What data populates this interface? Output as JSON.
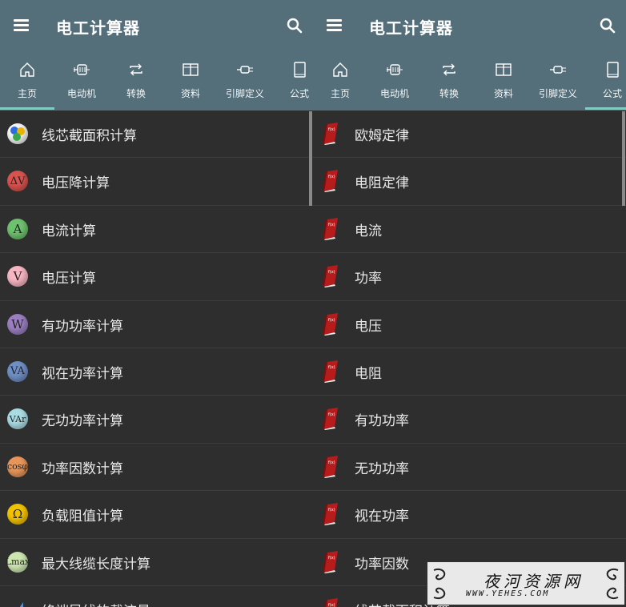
{
  "app": {
    "title": "电工计算器",
    "tabs": [
      {
        "label": "主页",
        "icon": "home-icon"
      },
      {
        "label": "电动机",
        "icon": "motor-icon"
      },
      {
        "label": "转换",
        "icon": "repeat-icon"
      },
      {
        "label": "资料",
        "icon": "book-open-icon"
      },
      {
        "label": "引脚定义",
        "icon": "plug-icon"
      },
      {
        "label": "公式",
        "icon": "book-icon"
      }
    ]
  },
  "left": {
    "selected_tab": "主页",
    "items": [
      {
        "label": "线芯截面积计算",
        "glyph": "",
        "color": "#5a8fd6"
      },
      {
        "label": "电压降计算",
        "glyph": "ΔV",
        "color": "#d9534f"
      },
      {
        "label": "电流计算",
        "glyph": "A",
        "color": "#6ec26e"
      },
      {
        "label": "电压计算",
        "glyph": "V",
        "color": "#f7b6c2"
      },
      {
        "label": "有功功率计算",
        "glyph": "W",
        "color": "#9b7fc0"
      },
      {
        "label": "视在功率计算",
        "glyph": "VA",
        "color": "#6f8fc6"
      },
      {
        "label": "无功功率计算",
        "glyph": "VAr",
        "color": "#a9dbe3"
      },
      {
        "label": "功率因数计算",
        "glyph": "cosφ",
        "color": "#e8955a"
      },
      {
        "label": "负载阻值计算",
        "glyph": "Ω",
        "color": "#f2c200"
      },
      {
        "label": "最大线缆长度计算",
        "glyph": "Lmax",
        "color": "#cde6b0"
      },
      {
        "label": "终端导线的载流量",
        "glyph": "",
        "color": "#5a8fd6"
      }
    ]
  },
  "right": {
    "selected_tab": "公式",
    "items": [
      {
        "label": "欧姆定律"
      },
      {
        "label": "电阻定律"
      },
      {
        "label": "电流"
      },
      {
        "label": "功率"
      },
      {
        "label": "电压"
      },
      {
        "label": "电阻"
      },
      {
        "label": "有功功率"
      },
      {
        "label": "无功功率"
      },
      {
        "label": "视在功率"
      },
      {
        "label": "功率因数"
      },
      {
        "label": "线芯截面积计算"
      }
    ]
  },
  "watermark": {
    "title": "夜河资源网",
    "url": "WWW.YEHES.COM"
  },
  "colors": {
    "appbar": "#546e7a",
    "indicator": "#80cbc4",
    "background": "#2e2e2e",
    "book": "#b71c1c"
  }
}
